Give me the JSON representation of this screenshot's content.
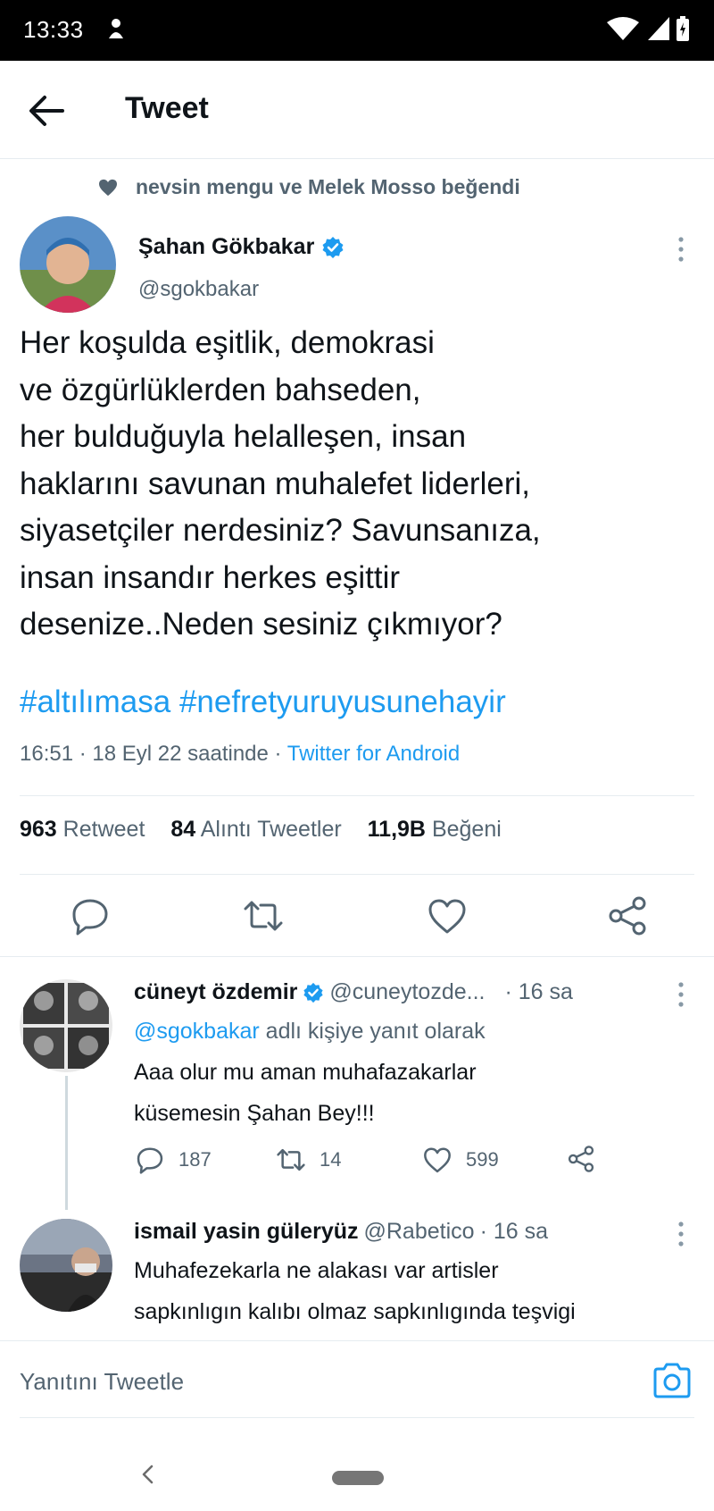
{
  "status_bar": {
    "time": "13:33"
  },
  "app_bar": {
    "title": "Tweet"
  },
  "social_context": "nevsin mengu ve Melek Mosso beğendi",
  "tweet": {
    "author_name": "Şahan Gökbakar",
    "author_handle": "@sgokbakar",
    "text_lines": [
      "Her koşulda eşitlik, demokrasi",
      "ve özgürlüklerden bahseden,",
      "her bulduğuyla helalleşen, insan",
      "haklarını savunan muhalefet liderleri,",
      "siyasetçiler nerdesiniz? Savunsanıza,",
      "insan insandır herkes eşittir",
      "desenize..Neden sesiniz çıkmıyor?"
    ],
    "hashtags": "#altılımasa #nefretyuruyusunehayir",
    "timestamp": "16:51 · 18 Eyl 22 saatinde · ",
    "source": "Twitter for Android",
    "stats": {
      "retweets_count": "963",
      "retweets_label": "Retweet",
      "quotes_count": "84",
      "quotes_label": "Alıntı Tweetler",
      "likes_count": "11,9B",
      "likes_label": "Beğeni"
    }
  },
  "replies": [
    {
      "name": "cüneyt özdemir",
      "handle": "@cuneytozde...",
      "time": "· 16 sa",
      "reply_to_mention": "@sgokbakar",
      "reply_to_suffix": " adlı kişiye yanıt olarak",
      "text_lines": [
        "Aaa olur mu aman muhafazakarlar",
        "küsemesin Şahan Bey!!!"
      ],
      "replies_count": "187",
      "retweets_count": "14",
      "likes_count": "599"
    },
    {
      "name": "ismail yasin güleryüz",
      "handle": "@Rabetico",
      "time": "· 16 sa",
      "text_lines": [
        "Muhafezekarla ne alakası var artisler",
        "sapkınlıgın kalıbı olmaz sapkınlıgında  teşvigi"
      ]
    }
  ],
  "composer": {
    "placeholder": "Yanıtını Tweetle"
  },
  "colors": {
    "accent": "#1d9bf0",
    "muted": "#536471",
    "text": "#0f1419",
    "divider": "#e6ecf0"
  }
}
